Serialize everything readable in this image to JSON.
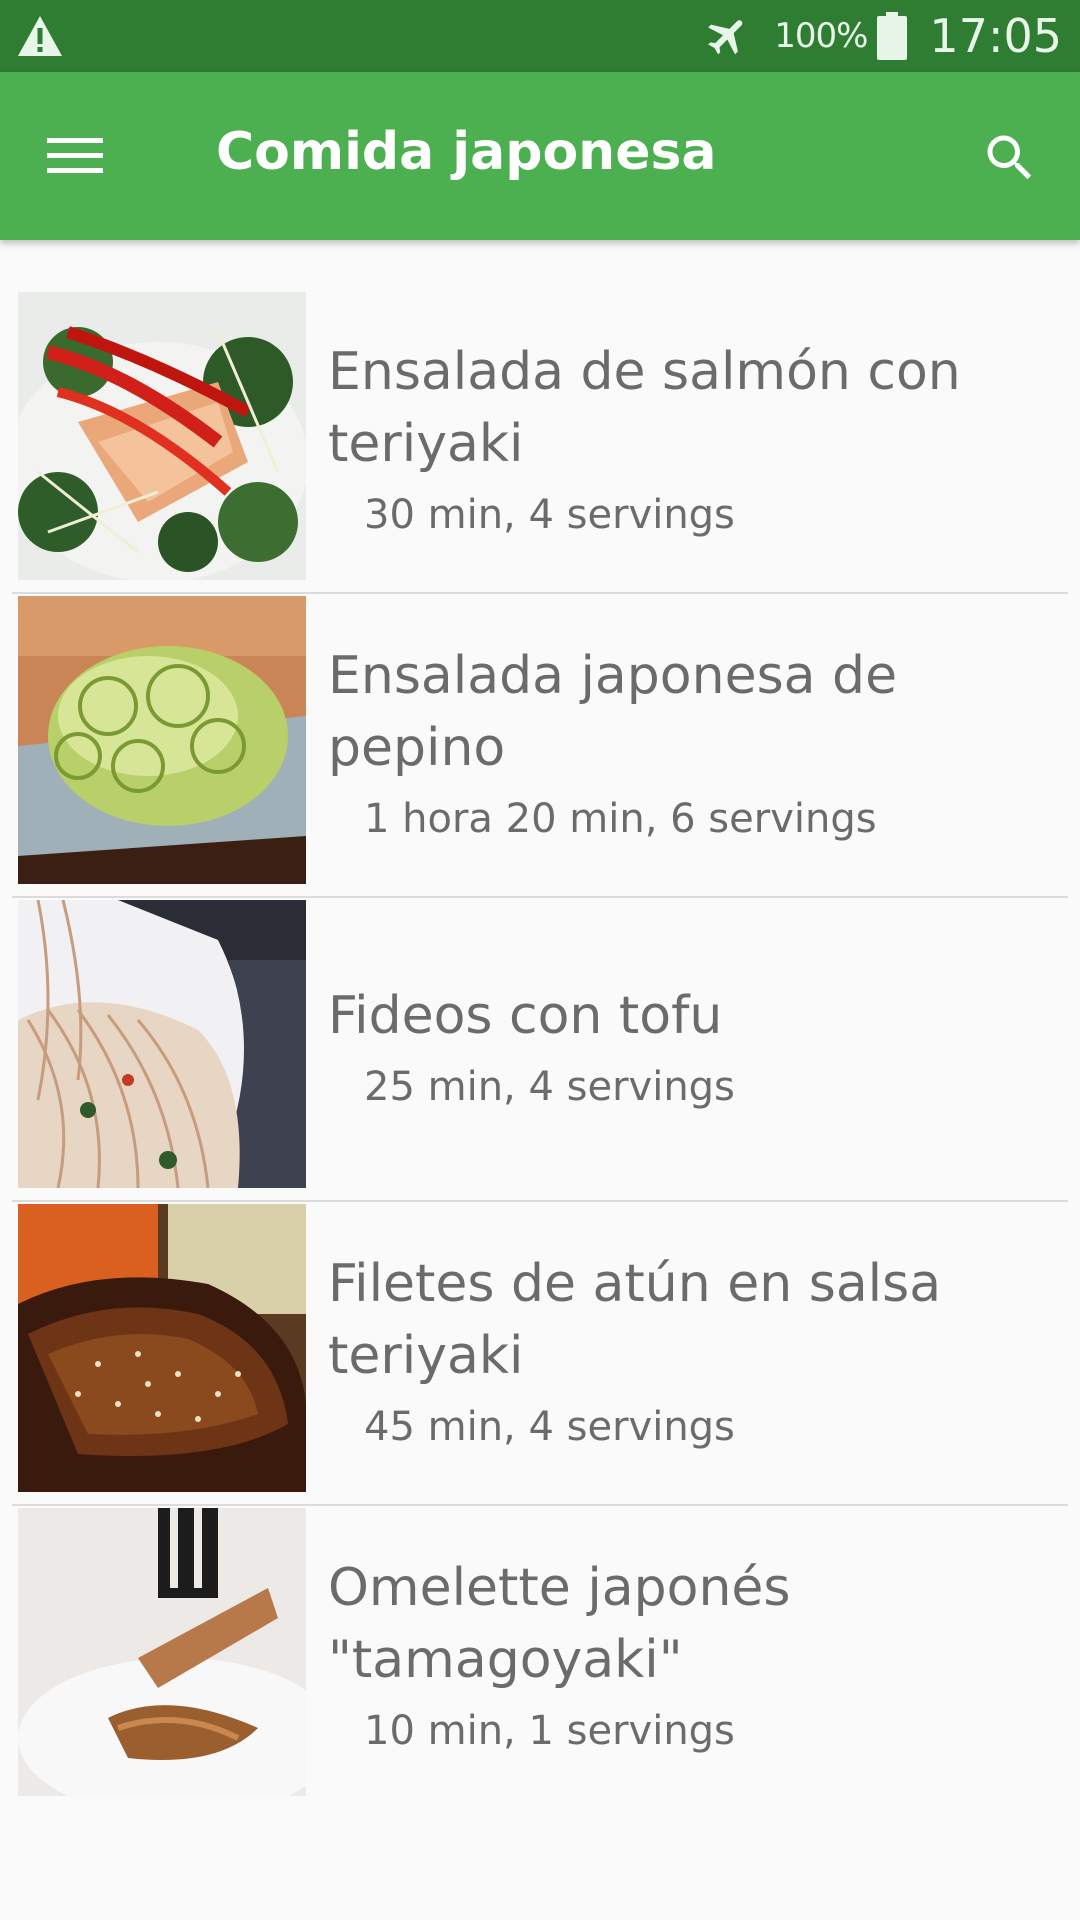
{
  "status_bar": {
    "warning_icon": "warning-triangle-icon",
    "airplane_icon": "airplane-mode-icon",
    "battery_percent": "100%",
    "battery_icon": "battery-full-icon",
    "time": "17:05"
  },
  "app_bar": {
    "menu_icon": "hamburger-menu-icon",
    "title": "Comida japonesa",
    "search_icon": "search-icon",
    "color": "#4caf50",
    "status_color": "#2e7d32"
  },
  "recipes": [
    {
      "title": "Ensalada de salmón con teriyaki",
      "meta": "30 min, 4 servings"
    },
    {
      "title": "Ensalada japonesa de pepino",
      "meta": "1 hora 20 min, 6 servings"
    },
    {
      "title": "Fideos con tofu",
      "meta": "25 min, 4 servings"
    },
    {
      "title": "Filetes de atún en salsa teriyaki",
      "meta": "45 min, 4 servings"
    },
    {
      "title": "Omelette japonés \"tamagoyaki\"",
      "meta": "10 min, 1 servings"
    }
  ]
}
